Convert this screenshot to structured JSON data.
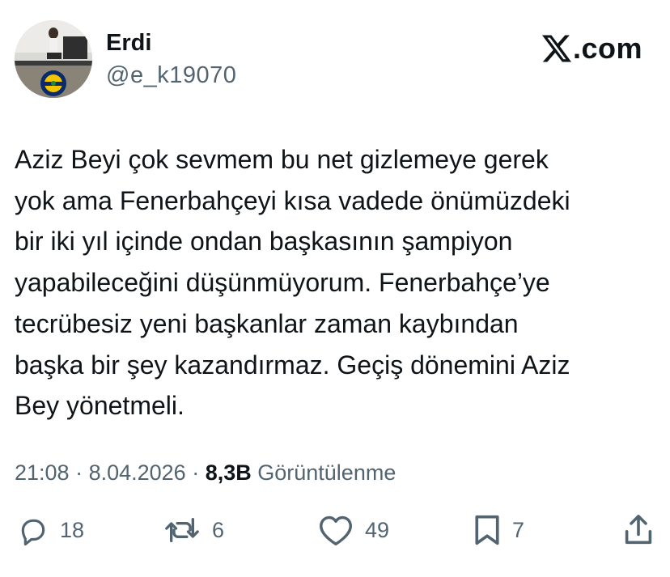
{
  "author": {
    "display_name": "Erdi",
    "handle": "@e_k19070",
    "avatar_icon": "avatar-photo"
  },
  "brand": {
    "suffix": ".com",
    "icon": "x-logo-icon"
  },
  "tweet": {
    "text": "Aziz Beyi çok sevmem bu net gizlemeye gerek\nyok ama Fenerbahçeyi kısa vadede önümüzdeki\nbir iki yıl içinde ondan başkasının şampiyon\nyapabileceğini düşünmüyorum. Fenerbahçe’ye\ntecrübesiz yeni başkanlar zaman kaybından\nbaşka bir şey kazandırmaz. Geçiş dönemini Aziz\nBey yönetmeli."
  },
  "meta": {
    "time": "21:08",
    "separator": " · ",
    "date": "8.04.2026",
    "views_count": "8,3B",
    "views_label": " Görüntülenme"
  },
  "actions": {
    "replies": "18",
    "retweets": "6",
    "likes": "49",
    "bookmarks": "7"
  },
  "colors": {
    "text": "#0f1419",
    "secondary": "#536471",
    "background": "#ffffff"
  }
}
